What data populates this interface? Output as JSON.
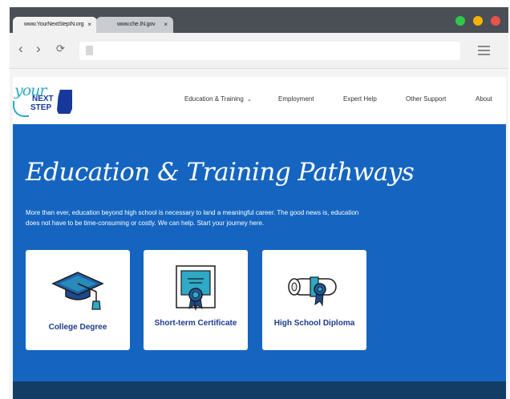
{
  "browser": {
    "tabs": [
      {
        "label": "www.YourNextStepIN.org",
        "close": "×"
      },
      {
        "label": "www.che.IN.gov",
        "close": "×"
      }
    ],
    "nav": {
      "back": "‹",
      "forward": "›",
      "reload": "⟳"
    },
    "address_value": "",
    "window_controls": {
      "colors": [
        "#2ec84a",
        "#f5b300",
        "#e9514d"
      ]
    }
  },
  "site": {
    "logo": {
      "line1": "your",
      "line2": "NEXT",
      "line3": "STEP"
    },
    "nav": [
      {
        "label": "Education & Training",
        "has_dropdown": true,
        "caret": "⌄"
      },
      {
        "label": "Employment"
      },
      {
        "label": "Expert Help"
      },
      {
        "label": "Other Support"
      },
      {
        "label": "About"
      }
    ],
    "hero": {
      "heading": "Education & Training Pathways",
      "intro": "More than ever, education beyond high school is necessary to land a meaningful career. The good news is, education does not have to be time-consuming or costly. We can help. Start your journey here.",
      "cards": [
        {
          "title": "College Degree",
          "icon": "graduation-cap-icon"
        },
        {
          "title": "Short-term Certificate",
          "icon": "certificate-icon"
        },
        {
          "title": "High School Diploma",
          "icon": "diploma-icon"
        }
      ]
    },
    "colors": {
      "hero_blue": "#1565c0",
      "title_navy": "#1d3b8f",
      "accent_teal": "#2ea9c6",
      "footer": "#143d66"
    }
  }
}
